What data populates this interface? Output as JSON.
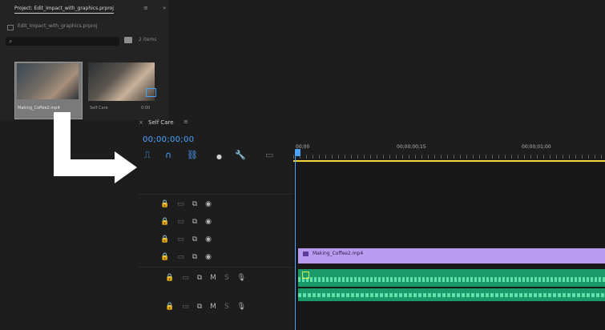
{
  "project_panel": {
    "tab_title": "Project: Edit_Impact_with_graphics.prproj",
    "tab_close": "≡",
    "menu": "»",
    "path": "Edit_Impact_with_graphics.prproj",
    "search_icon": "search-icon",
    "item_count": "2 items",
    "clips": [
      {
        "label": "Making_Coffee2.mp4",
        "duration": ""
      },
      {
        "label": "Self Care",
        "duration": "0:00"
      }
    ]
  },
  "timeline": {
    "close": "×",
    "sequence_name": "Self Care",
    "menu": "≡",
    "timecode": "00;00;00;00",
    "ruler_labels": [
      "00;00",
      "00;00;00;15",
      "00;00;01;00"
    ],
    "video_clip_label": "Making_Coffee2.mp4",
    "colors": {
      "accent": "#4da3ff",
      "playhead": "#4da3ff",
      "work_area": "#f2d63a",
      "video_clip": "#b99cf0",
      "audio_clip": "#1a9a6a"
    }
  }
}
